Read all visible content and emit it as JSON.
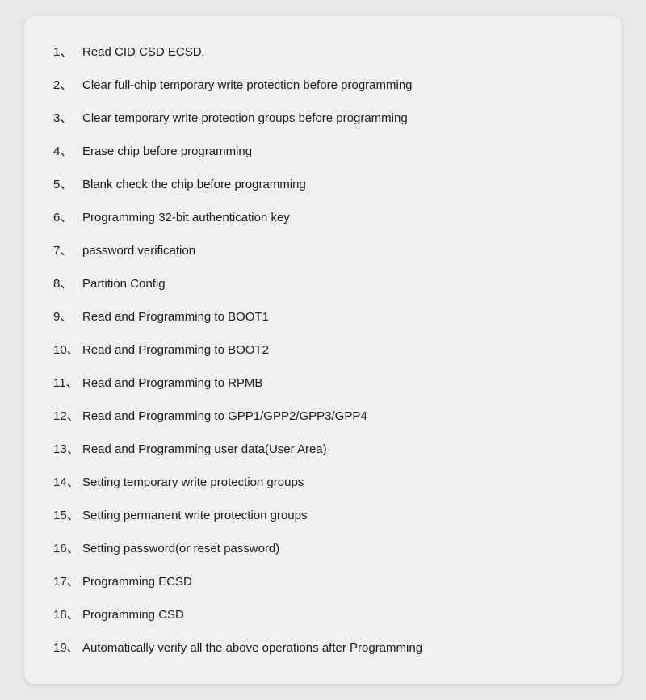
{
  "list": {
    "items": [
      {
        "number": "1",
        "text": "Read CID CSD ECSD."
      },
      {
        "number": "2",
        "text": "Clear full-chip temporary write protection before programming"
      },
      {
        "number": "3",
        "text": "Clear temporary write protection groups before programming"
      },
      {
        "number": "4",
        "text": "Erase chip before programming"
      },
      {
        "number": "5",
        "text": "Blank check the chip before programming"
      },
      {
        "number": "6",
        "text": "Programming 32-bit authentication key"
      },
      {
        "number": "7",
        "text": "password verification"
      },
      {
        "number": "8",
        "text": "Partition Config"
      },
      {
        "number": "9",
        "text": "Read and Programming to BOOT1"
      },
      {
        "number": "10",
        "text": "Read and Programming to BOOT2"
      },
      {
        "number": "11",
        "text": "Read and Programming to RPMB"
      },
      {
        "number": "12",
        "text": "Read and Programming to GPP1/GPP2/GPP3/GPP4"
      },
      {
        "number": "13",
        "text": "Read and Programming user data(User Area)"
      },
      {
        "number": "14",
        "text": "Setting temporary write protection groups"
      },
      {
        "number": "15",
        "text": "Setting permanent write protection groups"
      },
      {
        "number": "16",
        "text": "Setting password(or reset password)"
      },
      {
        "number": "17",
        "text": "Programming ECSD"
      },
      {
        "number": "18",
        "text": "Programming CSD"
      },
      {
        "number": "19",
        "text": "Automatically verify all the above operations after Programming"
      }
    ]
  }
}
